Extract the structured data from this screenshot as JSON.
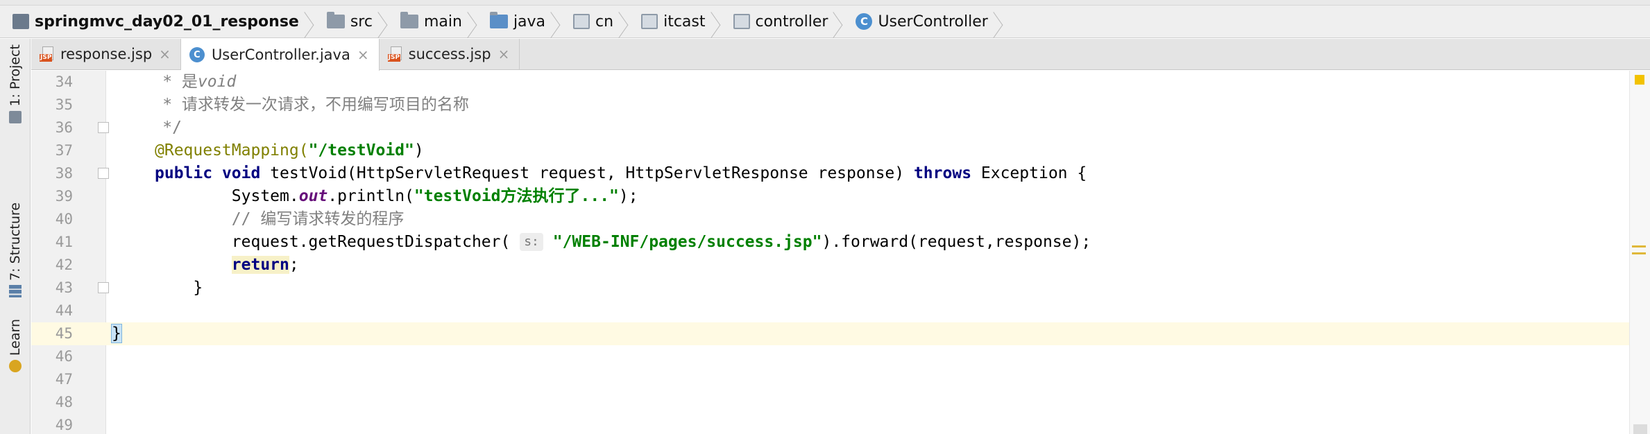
{
  "breadcrumb": {
    "project": "springmvc_day02_01_response",
    "items": [
      "src",
      "main",
      "java",
      "cn",
      "itcast",
      "controller",
      "UserController"
    ]
  },
  "left_panel": {
    "project": "1: Project",
    "structure": "7: Structure",
    "learn": "Learn"
  },
  "tabs": [
    {
      "label": "response.jsp",
      "icon": "jsp-file-icon",
      "active": false
    },
    {
      "label": "UserController.java",
      "icon": "java-class-icon",
      "active": true
    },
    {
      "label": "success.jsp",
      "icon": "jsp-file-icon",
      "active": false
    }
  ],
  "editor": {
    "current_line": 45,
    "lines": [
      {
        "n": "34",
        "text": ""
      },
      {
        "n": "35",
        "text": ""
      },
      {
        "n": "36",
        "text": ""
      },
      {
        "n": "37",
        "text": ""
      },
      {
        "n": "38",
        "text": ""
      },
      {
        "n": "39",
        "text": ""
      },
      {
        "n": "40",
        "text": ""
      },
      {
        "n": "41",
        "text": ""
      },
      {
        "n": "42",
        "text": ""
      },
      {
        "n": "43",
        "text": ""
      },
      {
        "n": "44",
        "text": ""
      },
      {
        "n": "45",
        "text": ""
      },
      {
        "n": "46",
        "text": ""
      },
      {
        "n": "47",
        "text": ""
      },
      {
        "n": "48",
        "text": ""
      },
      {
        "n": "49",
        "text": ""
      }
    ],
    "code": {
      "l34_star": "     * 是",
      "l34_void": "void",
      "l35": "     * 请求转发一次请求，不用编写项目的名称",
      "l36": "     */",
      "l37_ann": "@RequestMapping(",
      "l37_str": "\"/testVoid\"",
      "l37_end": ")",
      "l38_kw1": "public",
      "l38_kw2": "void",
      "l38_mid": " testVoid(HttpServletRequest request, HttpServletResponse response) ",
      "l38_kw3": "throws",
      "l38_end": " Exception {",
      "l39_a": "        System.",
      "l39_out": "out",
      "l39_b": ".println(",
      "l39_str": "\"testVoid方法执行了...\"",
      "l39_c": ");",
      "l40": "        // 编写请求转发的程序",
      "l41_a": "        request.getRequestDispatcher( ",
      "l41_hint": "s:",
      "l41_str": " \"/WEB-INF/pages/success.jsp\"",
      "l41_b": ").forward(request,response);",
      "l42_kw": "return",
      "l42_end": ";",
      "l43": "    }",
      "l45": "}"
    }
  }
}
